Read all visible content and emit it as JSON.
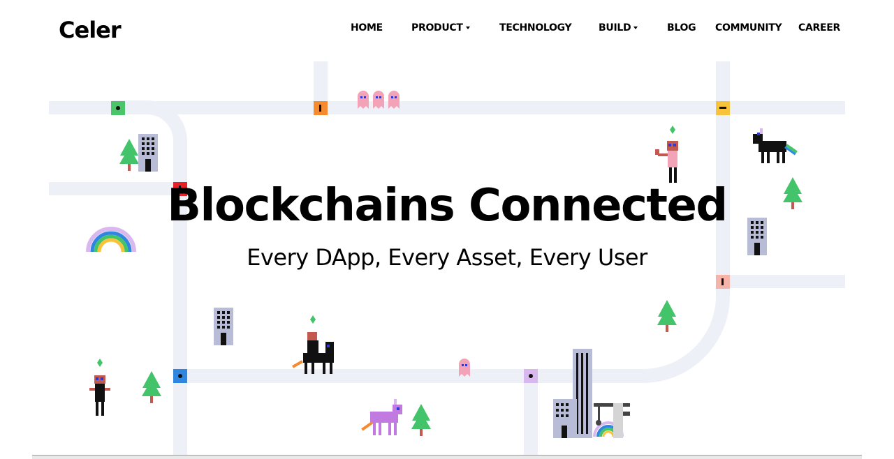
{
  "brand": {
    "logo": "Celer"
  },
  "nav": {
    "items": [
      {
        "label": "HOME",
        "dropdown": false
      },
      {
        "label": "PRODUCT",
        "dropdown": true
      },
      {
        "label": "TECHNOLOGY",
        "dropdown": false
      },
      {
        "label": "BUILD",
        "dropdown": true
      },
      {
        "label": "BLOG",
        "dropdown": false
      },
      {
        "label": "COMMUNITY",
        "dropdown": false
      },
      {
        "label": "CAREER",
        "dropdown": false
      }
    ]
  },
  "hero": {
    "title": "Blockchains Connected",
    "subtitle": "Every DApp, Every Asset, Every User"
  },
  "colors": {
    "road": "#eef0f8",
    "node_green": "#4cc56a",
    "node_orange": "#f58a2e",
    "node_yellow": "#f7c33a",
    "node_red": "#e8202a",
    "node_pink": "#f5b3aa",
    "node_blue": "#2f86e0",
    "node_lavender": "#d9b8f0",
    "tree": "#44c46a",
    "trunk": "#c45a4f",
    "building": "#b8bcd6"
  },
  "icons": [
    "tree-icon",
    "building-icon",
    "rainbow-icon",
    "unicorn-icon",
    "character-icon",
    "ghost-icon",
    "tower-icon",
    "crane-icon"
  ]
}
